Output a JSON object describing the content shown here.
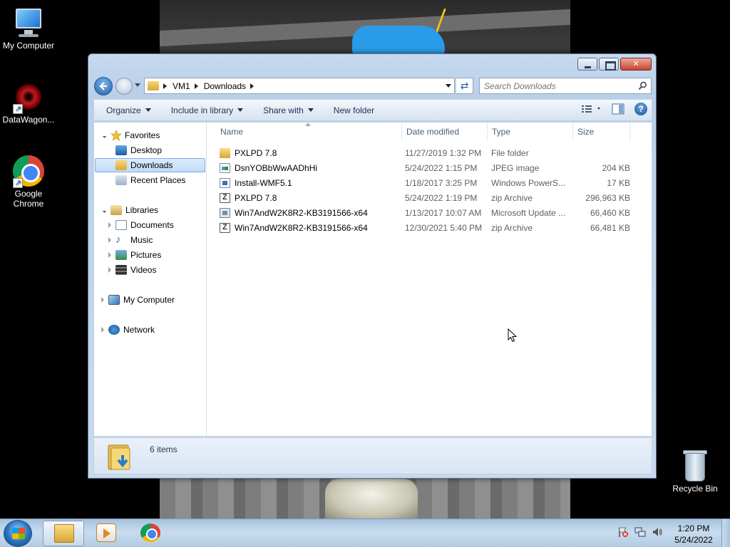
{
  "desktop": {
    "icons": [
      {
        "label": "My Computer"
      },
      {
        "label": "DataWagon..."
      },
      {
        "label": "Google Chrome"
      },
      {
        "label": "Recycle Bin"
      }
    ]
  },
  "window": {
    "address": {
      "segments": [
        "VM1",
        "Downloads"
      ]
    },
    "search": {
      "placeholder": "Search Downloads"
    },
    "toolbar": {
      "organize": "Organize",
      "include_in_library": "Include in library",
      "share_with": "Share with",
      "new_folder": "New folder"
    },
    "navpane": {
      "favorites": "Favorites",
      "desktop": "Desktop",
      "downloads": "Downloads",
      "recent_places": "Recent Places",
      "libraries": "Libraries",
      "documents": "Documents",
      "music": "Music",
      "pictures": "Pictures",
      "videos": "Videos",
      "my_computer": "My Computer",
      "network": "Network"
    },
    "columns": {
      "name": "Name",
      "date": "Date modified",
      "type": "Type",
      "size": "Size"
    },
    "files": [
      {
        "name": "PXLPD 7.8",
        "date": "11/27/2019 1:32 PM",
        "type": "File folder",
        "size": "",
        "icon": "folder-icon"
      },
      {
        "name": "DsnYOBbWwAADhHi",
        "date": "5/24/2022 1:15 PM",
        "type": "JPEG image",
        "size": "204 KB",
        "icon": "jpeg-file-icon"
      },
      {
        "name": "Install-WMF5.1",
        "date": "1/18/2017 3:25 PM",
        "type": "Windows PowerS...",
        "size": "17 KB",
        "icon": "powershell-file-icon"
      },
      {
        "name": "PXLPD 7.8",
        "date": "5/24/2022 1:19 PM",
        "type": "zip Archive",
        "size": "296,963 KB",
        "icon": "zip-file-icon"
      },
      {
        "name": "Win7AndW2K8R2-KB3191566-x64",
        "date": "1/13/2017 10:07 AM",
        "type": "Microsoft Update ...",
        "size": "66,460 KB",
        "icon": "msu-file-icon"
      },
      {
        "name": "Win7AndW2K8R2-KB3191566-x64",
        "date": "12/30/2021 5:40 PM",
        "type": "zip Archive",
        "size": "66,481 KB",
        "icon": "zip-file-icon"
      }
    ],
    "status": {
      "count": "6 items"
    }
  },
  "taskbar": {
    "clock_time": "1:20 PM",
    "clock_date": "5/24/2022"
  }
}
